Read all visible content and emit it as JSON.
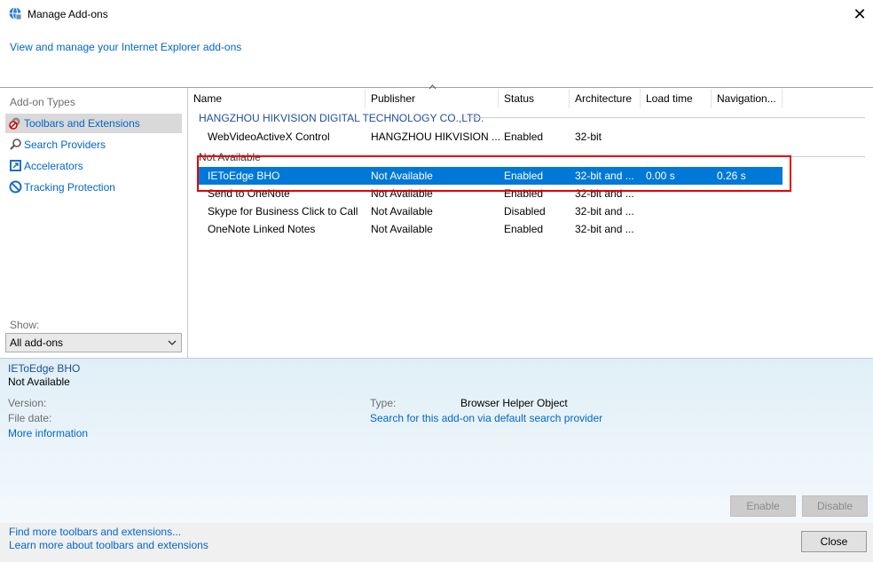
{
  "window": {
    "title": "Manage Add-ons",
    "close_glyph": "✕"
  },
  "header": {
    "link": "View and manage your Internet Explorer add-ons"
  },
  "left": {
    "types_label": "Add-on Types",
    "types": [
      {
        "label": "Toolbars and Extensions",
        "icon": "gear-block-icon"
      },
      {
        "label": "Search Providers",
        "icon": "search-icon"
      },
      {
        "label": "Accelerators",
        "icon": "accelerator-icon"
      },
      {
        "label": "Tracking Protection",
        "icon": "block-icon"
      }
    ],
    "show_label": "Show:",
    "show_value": "All add-ons"
  },
  "list": {
    "columns": [
      "Name",
      "Publisher",
      "Status",
      "Architecture",
      "Load time",
      "Navigation..."
    ],
    "groups": [
      {
        "label": "HANGZHOU HIKVISION DIGITAL TECHNOLOGY CO.,LTD.",
        "rows": [
          {
            "name": "WebVideoActiveX Control",
            "publisher": "HANGZHOU HIKVISION ...",
            "status": "Enabled",
            "arch": "32-bit",
            "load": "",
            "nav": ""
          }
        ]
      },
      {
        "label": "Not Available",
        "rows": [
          {
            "name": "IEToEdge BHO",
            "publisher": "Not Available",
            "status": "Enabled",
            "arch": "32-bit and ...",
            "load": "0.00 s",
            "nav": "0.26 s"
          },
          {
            "name": "Send to OneNote",
            "publisher": "Not Available",
            "status": "Enabled",
            "arch": "32-bit and ...",
            "load": "",
            "nav": ""
          },
          {
            "name": "Skype for Business Click to Call",
            "publisher": "Not Available",
            "status": "Disabled",
            "arch": "32-bit and ...",
            "load": "",
            "nav": ""
          },
          {
            "name": "OneNote Linked Notes",
            "publisher": "Not Available",
            "status": "Enabled",
            "arch": "32-bit and ...",
            "load": "",
            "nav": ""
          }
        ]
      }
    ]
  },
  "detail": {
    "name": "IEToEdge BHO",
    "publisher": "Not Available",
    "version_label": "Version:",
    "file_date_label": "File date:",
    "more_info": "More information",
    "type_label": "Type:",
    "type_value": "Browser Helper Object",
    "search_link": "Search for this add-on via default search provider",
    "enable_button": "Enable",
    "disable_button": "Disable"
  },
  "footer": {
    "find_more": "Find more toolbars and extensions...",
    "learn_more": "Learn more about toolbars and extensions",
    "close_button": "Close"
  }
}
